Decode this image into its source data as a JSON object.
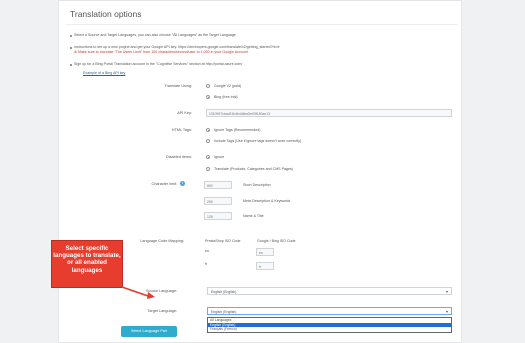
{
  "panel": {
    "title": "Translation options"
  },
  "info": {
    "line1": "Select a Source and Target Languages, you can also choose \"All Languages\" as the Target Language",
    "line2a": "Instructions to set up a new project and get your Google API key: https://developers.google.com/translate/v2/getting_started?hl=fr",
    "line2b": "⊗ Make sure to increase \"The Users Limit\" from 100 characters/second/user to 1,000 in your Google Account",
    "line3": "Sign up for a Bing Portal Translation account in the \"Cognitive Services\" section at http://portal.azure.com/",
    "example_link": "Example of a Bing API key"
  },
  "form": {
    "translate_using": {
      "label": "Translate Using:",
      "options": [
        "Google V2 (paid)",
        "Bing (free trial)"
      ],
      "selected_index": 1
    },
    "api_key": {
      "label": "API Key:",
      "value": "1310997cbad31b4b4d6ed2e09f150ae13"
    },
    "html_tags": {
      "label": "HTML Tags:",
      "options": [
        "Ignore Tags (Recommended)",
        "Include Tags (Use if ignore tags doesn't work correctly)"
      ],
      "selected_index": 0
    },
    "disabled_items": {
      "label": "Disabled items:",
      "options": [
        "Ignore",
        "Translate (Products, Categories and CMS Pages)"
      ],
      "selected_index": 0
    },
    "character_limit": {
      "label": "Character limit:",
      "info_glyph": "i",
      "rows": [
        {
          "value": "800",
          "desc": "Short Description"
        },
        {
          "value": "255",
          "desc": "Meta Description & Keywords"
        },
        {
          "value": "128",
          "desc": "Name & Title"
        }
      ]
    },
    "language_code_mapping": {
      "label": "Language Code Mapping:",
      "col1": "PrestaShop ISO Code",
      "col2": "Google / Bing ISO Code",
      "rows": [
        {
          "iso": "en",
          "mapped": "en"
        },
        {
          "iso": "fr",
          "mapped": "fr"
        }
      ]
    },
    "source_language": {
      "label": "Source Language:",
      "value": "English (English)"
    },
    "target_language": {
      "label": "Target Language:",
      "value": "English (English)",
      "options": [
        "All Languages",
        "English (English)",
        "Français (French)"
      ],
      "highlighted_index": 1
    }
  },
  "button": {
    "select_language_pair": "Select Language Pair"
  },
  "callout": {
    "text": "Select specific languages to translate, or all enabled languages"
  },
  "colors": {
    "callout_red": "#e63d2f",
    "button_blue": "#2eacce",
    "dropdown_highlight": "#1e6fd9"
  }
}
